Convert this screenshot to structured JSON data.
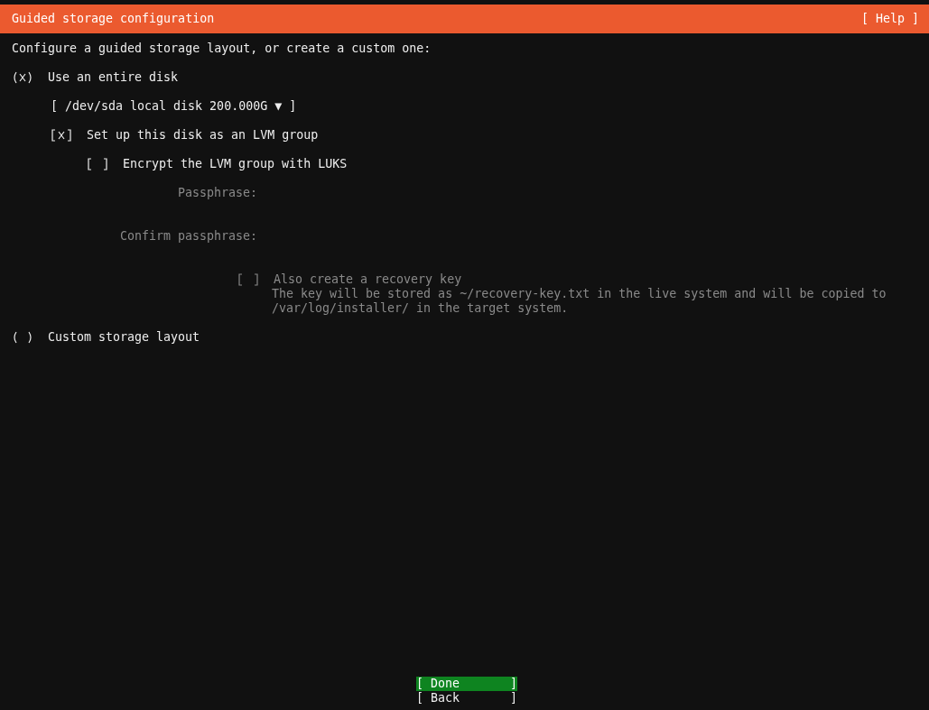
{
  "header": {
    "title": "Guided storage configuration",
    "help": "[ Help ]"
  },
  "intro": "Configure a guided storage layout, or create a custom one:",
  "options": [
    {
      "label": "Use an entire disk",
      "selected": true,
      "disk_select": "[ /dev/sda local disk 200.000G ▼ ]",
      "lvm": {
        "label": "Set up this disk as an LVM group",
        "checked": true,
        "disabled": false,
        "encrypt": {
          "label": "Encrypt the LVM group with LUKS",
          "checked": false,
          "disabled": false,
          "fields": [
            {
              "label": "Passphrase:",
              "disabled": true
            },
            {
              "label": "Confirm passphrase:",
              "disabled": true
            }
          ],
          "recovery": {
            "label": "Also create a recovery key",
            "checked": false,
            "disabled": true,
            "description": "The key will be stored as ~/recovery-key.txt in the live system and will be copied to\n/var/log/installer/ in the target system."
          }
        }
      }
    },
    {
      "label": "Custom storage layout",
      "selected": false
    }
  ],
  "buttons": [
    {
      "label": "[ Done       ]",
      "selected": true
    },
    {
      "label": "[ Back       ]",
      "selected": false
    }
  ]
}
